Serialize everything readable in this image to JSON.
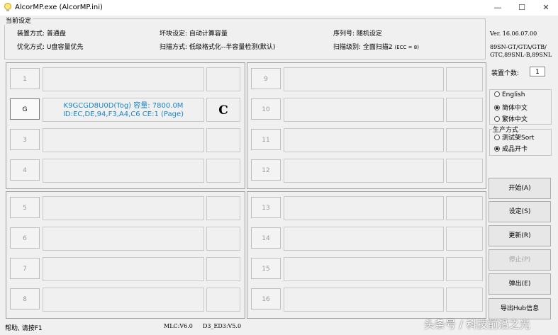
{
  "titlebar": {
    "title": "AlcorMP.exe (AlcorMP.ini)",
    "minimize": "—",
    "maximize": "☐",
    "close": "✕"
  },
  "settings": {
    "legend": "当前设定",
    "device_mode": "装置方式: 普通盘",
    "optimize": "优化方式: U盘容量优先",
    "bad_block": "坏块设定: 自动计算容量",
    "scan_mode": "扫描方式: 低级格式化--半容量检测(默认)",
    "serial": "序列号: 随机设定",
    "scan_level": "扫描级别: 全面扫描2",
    "scan_level_ecc": "(ECC = 8)"
  },
  "slots": {
    "panel1": [
      {
        "num": "1",
        "info1": "",
        "info2": "",
        "status": ""
      },
      {
        "num": "G",
        "info1": "K9GCGD8U0D(Tog) 容量: 7800.0M",
        "info2": "ID:EC,DE,94,F3,A4,C6 CE:1 (Page)",
        "status": "C"
      },
      {
        "num": "3",
        "info1": "",
        "info2": "",
        "status": ""
      },
      {
        "num": "4",
        "info1": "",
        "info2": "",
        "status": ""
      }
    ],
    "panel2": [
      {
        "num": "9"
      },
      {
        "num": "10"
      },
      {
        "num": "11"
      },
      {
        "num": "12"
      }
    ],
    "panel3": [
      {
        "num": "5"
      },
      {
        "num": "6"
      },
      {
        "num": "7"
      },
      {
        "num": "8"
      }
    ],
    "panel4": [
      {
        "num": "13"
      },
      {
        "num": "14"
      },
      {
        "num": "15"
      },
      {
        "num": "16"
      }
    ]
  },
  "side": {
    "version": "Ver. 16.06.07.00",
    "models": [
      "89SN-GT/GTA/GTB/",
      "GTC,89SNL-B,89SNL"
    ],
    "device_count_label": "装置个数:",
    "device_count": "1",
    "languages": [
      {
        "label": "English",
        "selected": false
      },
      {
        "label": "简体中文",
        "selected": true
      },
      {
        "label": "繁体中文",
        "selected": false
      }
    ],
    "production_label": "生产方式",
    "production": [
      {
        "label": "测试架Sort",
        "selected": false
      },
      {
        "label": "成品开卡",
        "selected": true
      }
    ],
    "buttons": {
      "start": "开始(A)",
      "settings": "设定(S)",
      "refresh": "更新(R)",
      "stop": "停止(P)",
      "eject": "弹出(E)",
      "export_hub": "导出Hub信息"
    }
  },
  "status": {
    "help": "帮助, 请按F1",
    "mlc": "MLC:V6.0",
    "ed3": "D3_ED3:V5.0"
  },
  "watermark": "头条号 / 科技前沿之光"
}
